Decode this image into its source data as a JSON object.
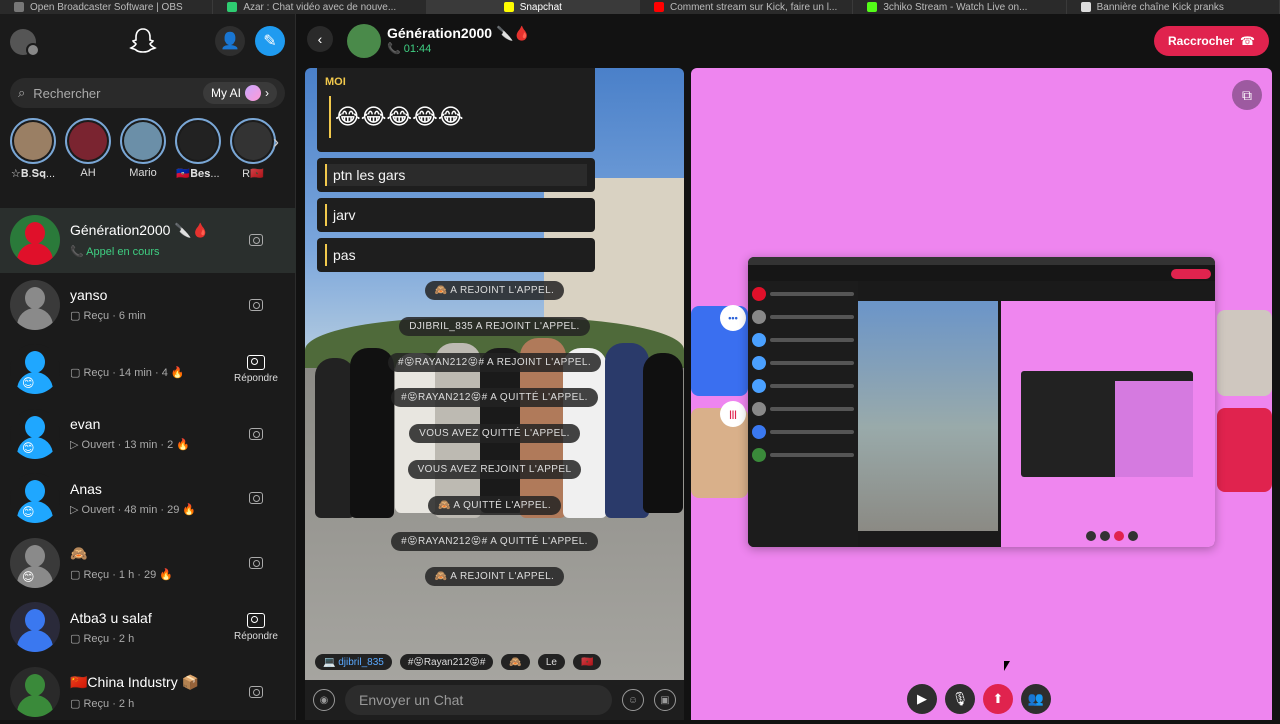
{
  "browser": {
    "tabs": [
      {
        "label": "Open Broadcaster Software | OBS",
        "color": "#777777"
      },
      {
        "label": "Azar : Chat vidéo avec de nouve...",
        "color": "#2ecc71"
      },
      {
        "label": "Snapchat",
        "color": "#fffc00",
        "active": true
      },
      {
        "label": "Comment stream sur Kick, faire un l...",
        "color": "#ff0000"
      },
      {
        "label": "3chiko Stream - Watch Live on...",
        "color": "#53fc18"
      },
      {
        "label": "Bannière chaîne Kick pranks",
        "color": "#dddddd"
      }
    ]
  },
  "sidebar": {
    "search_placeholder": "Rechercher",
    "myai_label": "My AI",
    "stories": [
      {
        "name": "☆𝐁.𝐒𝐪...",
        "color": "#9a7f64"
      },
      {
        "name": "AH",
        "color": "#7a2430"
      },
      {
        "name": "Mario",
        "color": "#6b8fa8"
      },
      {
        "name": "🇭🇹𝐁𝐞𝐬...",
        "color": "#222222"
      },
      {
        "name": "R🇲🇦",
        "color": "#333333"
      }
    ],
    "chats": [
      {
        "name": "Génération2000 🔪🩸",
        "status": "Appel en cours",
        "status_type": "call",
        "av_color": "#e0102a",
        "bg": "#2a7a3a",
        "selected": true,
        "action": ""
      },
      {
        "name": "yanso",
        "status": "Reçu · 6 min",
        "status_type": "received",
        "av_color": "#8a8a8a",
        "bg": "#3a3a3a",
        "action": ""
      },
      {
        "name": "",
        "status": "Reçu · 14 min · 4 🔥",
        "status_type": "received-purple",
        "av_color": "#1fa7ff",
        "bg": "#1b1b1b",
        "badge": "😊",
        "action": "Répondre"
      },
      {
        "name": "evan",
        "status": "Ouvert · 13 min · 2 🔥",
        "status_type": "opened",
        "av_color": "#1fa7ff",
        "bg": "#1b1b1b",
        "badge": "😊",
        "action": ""
      },
      {
        "name": "Anas",
        "status": "Ouvert · 48 min · 29 🔥",
        "status_type": "opened",
        "av_color": "#1fa7ff",
        "bg": "#1b1b1b",
        "badge": "😊",
        "action": ""
      },
      {
        "name": "🙈",
        "status": "Reçu · 1 h · 29 🔥",
        "status_type": "received",
        "av_color": "#8a8a8a",
        "bg": "#3a3a3a",
        "badge": "😊",
        "action": ""
      },
      {
        "name": "Atba3 u salaf",
        "status": "Reçu · 2 h",
        "status_type": "received-purple",
        "av_color": "#3a78f0",
        "bg": "#2a2a3a",
        "action": "Répondre"
      },
      {
        "name": "🇨🇳China Industry 📦",
        "status": "Reçu · 2 h",
        "status_type": "received",
        "av_color": "#3a8a3a",
        "bg": "#2a2a2a",
        "action": ""
      }
    ]
  },
  "header": {
    "title": "Génération2000 🔪🩸",
    "call_time": "📞 01:44",
    "hangup_label": "Raccrocher"
  },
  "conversation": {
    "sender": "MOI",
    "emojis": "😂😂😂😂😂",
    "messages": [
      "ptn les gars",
      "jarv",
      "pas"
    ],
    "system_messages": [
      "🙈 A REJOINT L'APPEL.",
      "DJIBRIL_835 A REJOINT L'APPEL.",
      "#😝RAYAN212😝# A REJOINT L'APPEL.",
      "#😝RAYAN212😝# A QUITTÉ L'APPEL.",
      "VOUS AVEZ QUITTÉ L'APPEL.",
      "VOUS AVEZ REJOINT L'APPEL",
      "🙈 A QUITTÉ L'APPEL.",
      "#😝RAYAN212😝# A QUITTÉ L'APPEL.",
      "🙈 A REJOINT L'APPEL."
    ],
    "presence": [
      "💻 djibril_835",
      "#😝Rayan212😝#",
      "🙈",
      "Le",
      "🇲🇦"
    ],
    "input_placeholder": "Envoyer un Chat"
  },
  "call_controls": {
    "buttons": [
      "camera",
      "microphone",
      "share-screen",
      "add-participant"
    ]
  },
  "colors": {
    "accent_blue": "#1f9bf0",
    "hangup_red": "#e0234e",
    "call_green": "#3fcf82",
    "pink_bg": "#ee85ef"
  }
}
